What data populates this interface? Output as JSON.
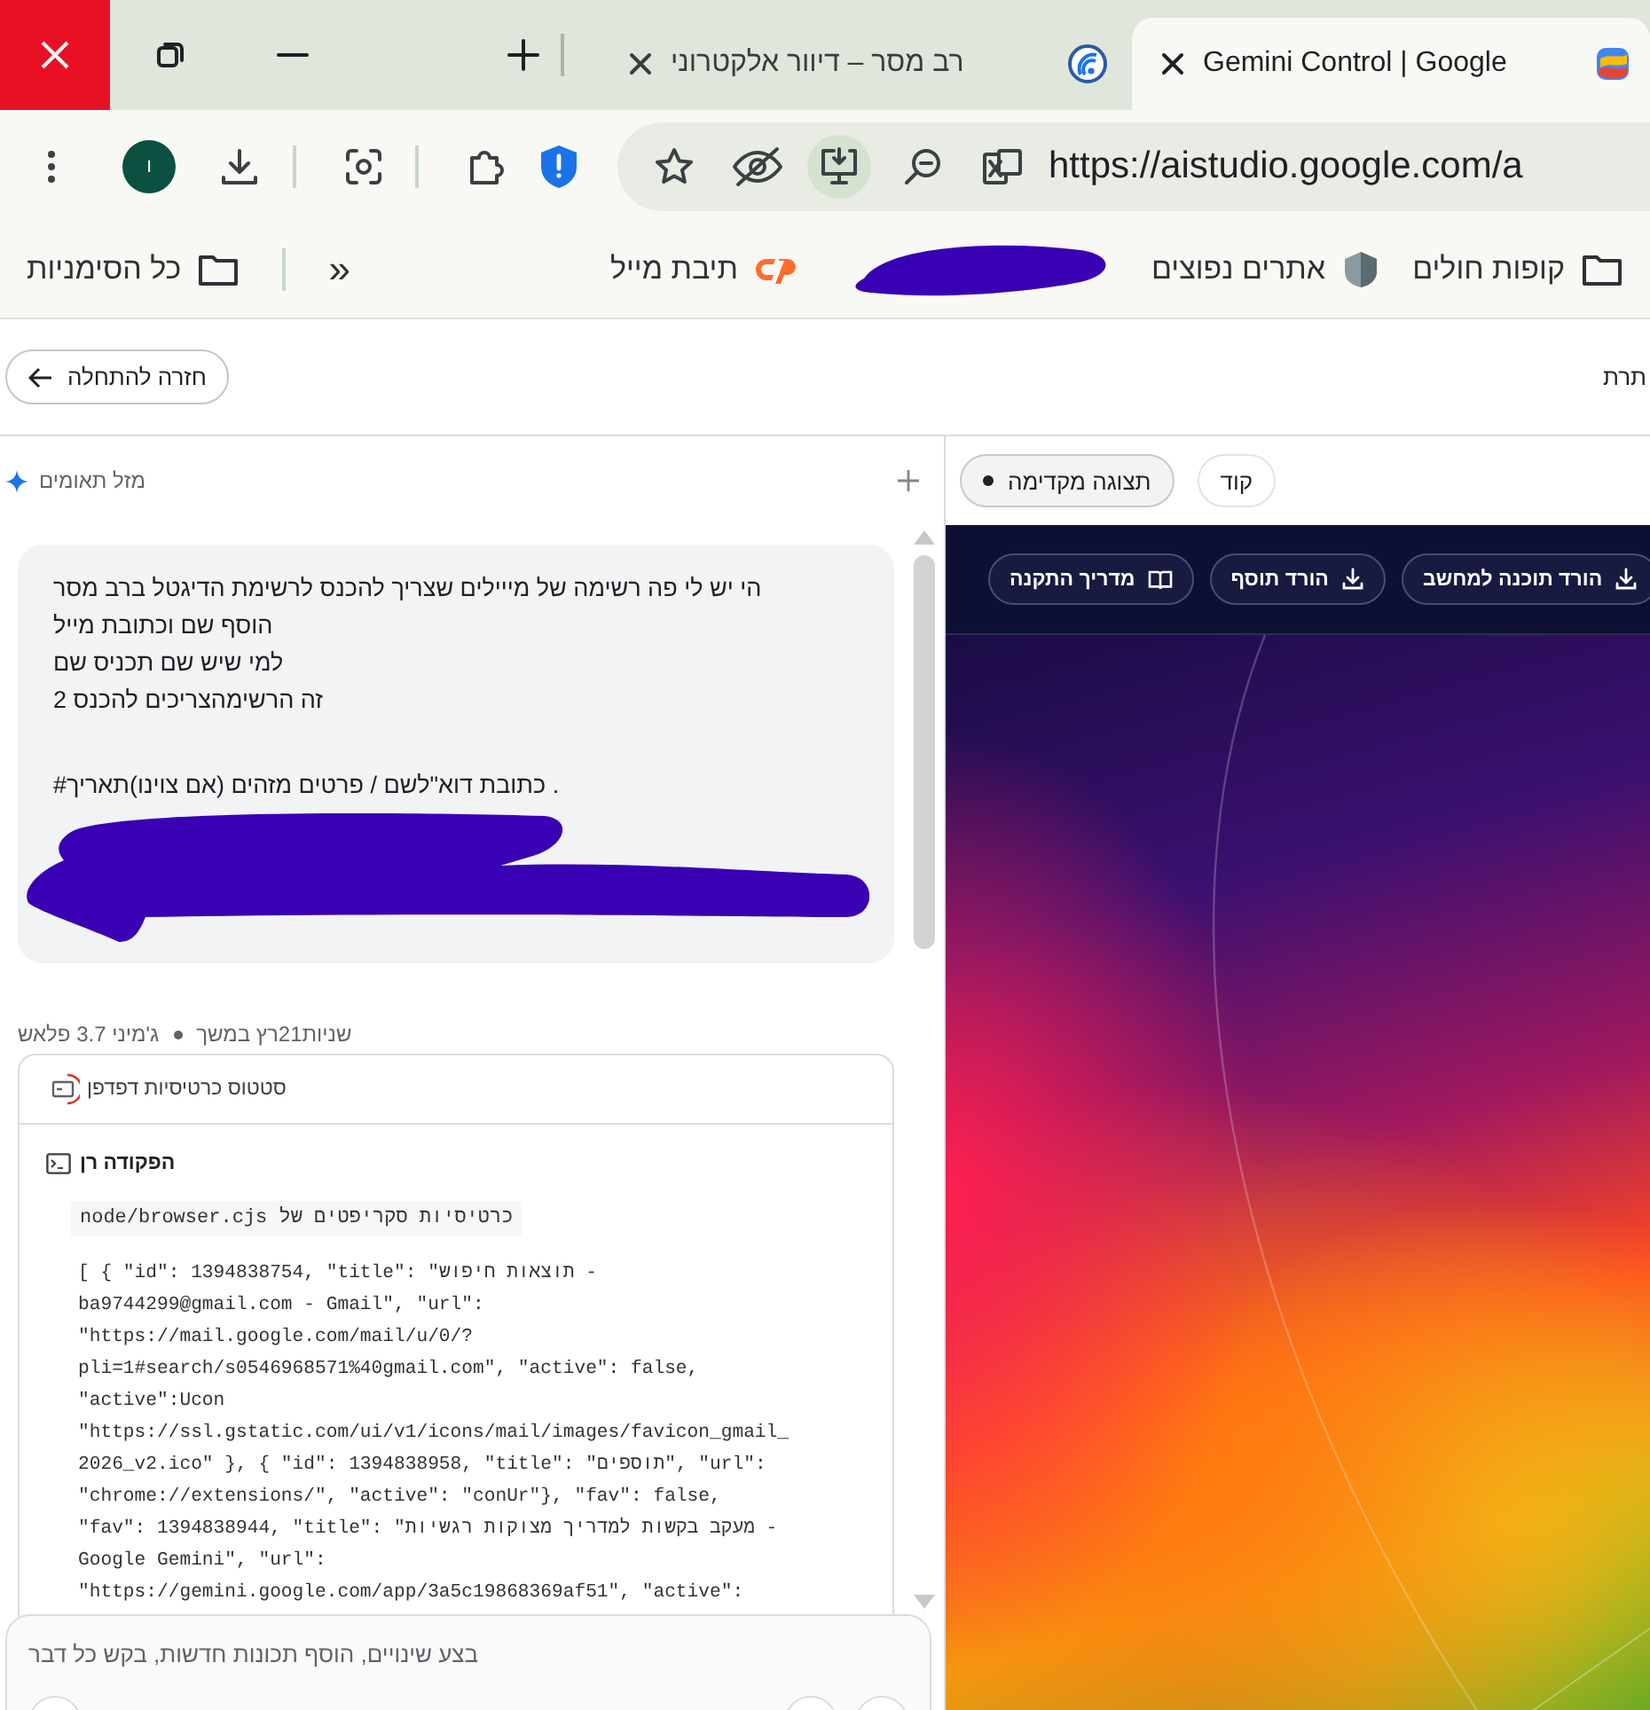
{
  "tabs": [
    {
      "title": "Gemini Control | Google",
      "kind": "studio",
      "selected": true
    },
    {
      "title": "רב מסר – דיוור אלקטרוני",
      "kind": "mailer",
      "selected": false
    }
  ],
  "toolbar": {
    "profile_initial": "ו",
    "url": "https://aistudio.google.com/a"
  },
  "bookmarks": {
    "items": [
      {
        "kind": "folder",
        "label": "קופות חולים"
      },
      {
        "kind": "site",
        "label": "אתרים נפוצים"
      },
      {
        "kind": "redacted"
      },
      {
        "kind": "cpanel",
        "label": "תיבת מייל"
      }
    ],
    "overflow": "»",
    "all_bookmarks": "כל הסימניות"
  },
  "app_header": {
    "back_button": "חזרה להתחלה",
    "title_fragment": "תרת"
  },
  "chat": {
    "title": "מזל תאומים",
    "message": [
      {
        "kind": "text",
        "lines": [
          "הי יש לי פה רשימה של מייילים שצריך להכנס לרשימת הדיגטל ברב מסר",
          "הוסף שם וכתובת מייל",
          "למי שיש שם תכניס שם",
          "זה הרשימהצריכים להכנס 2"
        ]
      },
      {
        "kind": "text",
        "lines": [
          "#כתובת דוא\"לשם / פרטים מזהים (אם צוינו)תאריך ."
        ]
      },
      {
        "kind": "redacted"
      }
    ],
    "meta": {
      "duration": "שניות21רץ במשך",
      "model": "ג'מיני 3.7 פלאש"
    },
    "tool_card": {
      "title": "סטטוס כרטיסיות דפדפן",
      "command_label": "הפקודה רן",
      "command": "node/browser.cjs כרטיסיות סקריפטים של",
      "output_lines": [
        "[ { \"id\": 1394838754, \"title\": \"תוצאות חיפוש -",
        "ba9744299@gmail.com - Gmail\", \"url\":",
        "\"https://mail.google.com/mail/u/0/?",
        "pli=1#search/s0546968571%40gmail.com\", \"active\": false,",
        "\"active\":Ucon",
        "\"https://ssl.gstatic.com/ui/v1/icons/mail/images/favicon_gmail_",
        "2026_v2.ico\" }, { \"id\": 1394838958, \"title\": \"תוספים\", \"url\":",
        "\"chrome://extensions/\", \"active\": \"conUr\"}, \"fav\": false,",
        "\"fav\": 1394838944, \"title\": \"מעקב בקשות למדריך מצוקות רגשיות -",
        "Google Gemini\", \"url\":",
        "\"https://gemini.google.com/app/3a5c19868369af51\", \"active\":"
      ]
    },
    "input": {
      "placeholder": "בצע שינויים, הוסף תכונות חדשות, בקש כל דבר"
    }
  },
  "preview": {
    "tabs": [
      {
        "label": "קוד",
        "selected": false
      },
      {
        "label": "תצוגה מקדימה",
        "selected": true
      }
    ],
    "actions": [
      {
        "kind": "download",
        "label": "הורד תוכנה למחשב"
      },
      {
        "kind": "download",
        "label": "הורד תוסף"
      },
      {
        "kind": "guide",
        "label": "מדריך התקנה"
      }
    ]
  }
}
